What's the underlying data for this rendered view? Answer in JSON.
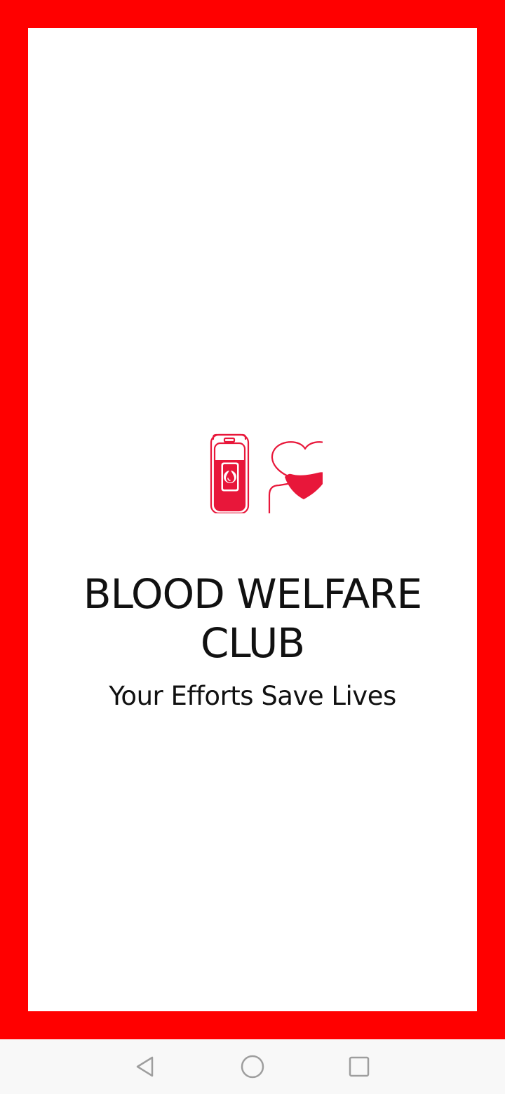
{
  "app": {
    "title_line1": "BLOOD WELFARE",
    "title_line2": "CLUB",
    "tagline": "Your Efforts Save Lives"
  },
  "logo": {
    "icon": "blood-bag-heart-icon"
  },
  "colors": {
    "frame": "#ff0000",
    "card": "#ffffff",
    "logo": "#e8173a",
    "text": "#111111",
    "navbar": "#f8f8f8",
    "nav_icon": "#9e9e9e"
  },
  "navbar": {
    "buttons": [
      "back-icon",
      "home-icon",
      "recents-icon"
    ]
  }
}
